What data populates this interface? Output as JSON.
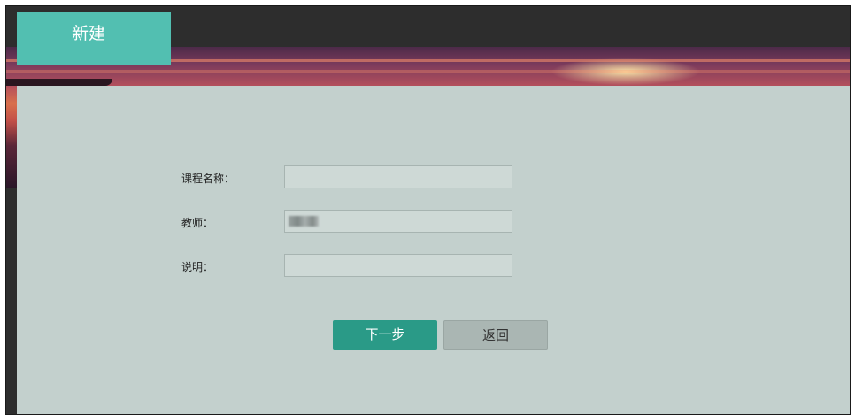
{
  "header": {
    "tab_label": "新建"
  },
  "form": {
    "course_name": {
      "label": "课程名称：",
      "value": ""
    },
    "teacher": {
      "label": "教师：",
      "value": ""
    },
    "description": {
      "label": "说明：",
      "value": ""
    }
  },
  "actions": {
    "next_label": "下一步",
    "back_label": "返回"
  },
  "colors": {
    "accent": "#52bfb1",
    "primary_button": "#2a9a87",
    "secondary_button": "#aab6b3",
    "panel": "#c3d0cd",
    "topbar": "#2d2d2d"
  }
}
